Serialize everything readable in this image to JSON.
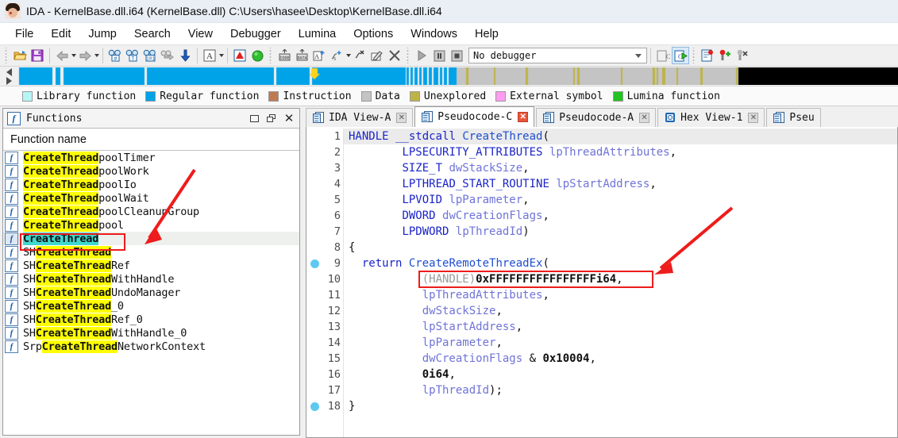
{
  "window": {
    "title": "IDA - KernelBase.dll.i64 (KernelBase.dll) C:\\Users\\hasee\\Desktop\\KernelBase.dll.i64",
    "app_icon": "ida-logo-icon"
  },
  "menubar": {
    "items": [
      "File",
      "Edit",
      "Jump",
      "Search",
      "View",
      "Debugger",
      "Lumina",
      "Options",
      "Windows",
      "Help"
    ]
  },
  "toolbar": {
    "debugger_select": {
      "value": "No debugger",
      "placeholder": "No debugger"
    },
    "buttons": [
      {
        "name": "open-file-icon",
        "glyph": "folder"
      },
      {
        "name": "save-file-icon",
        "glyph": "floppy"
      },
      {
        "name": "back-icon",
        "glyph": "arrow-left"
      },
      {
        "name": "back-dropdown-icon",
        "glyph": "caret"
      },
      {
        "name": "forward-icon",
        "glyph": "arrow-right"
      },
      {
        "name": "forward-dropdown-icon",
        "glyph": "caret"
      },
      {
        "name": "search-hash-icon",
        "glyph": "binoculars-hash"
      },
      {
        "name": "search-text-icon",
        "glyph": "binoculars-text"
      },
      {
        "name": "search-bytes-icon",
        "glyph": "binoculars-101"
      },
      {
        "name": "search-next-icon",
        "glyph": "binoculars-next"
      },
      {
        "name": "jump-down-icon",
        "glyph": "arrow-down"
      },
      {
        "name": "font-icon",
        "glyph": "letter-a"
      },
      {
        "name": "font-dropdown-icon",
        "glyph": "caret"
      },
      {
        "name": "warnings-icon",
        "glyph": "red-triangle"
      },
      {
        "name": "run-analysis-icon",
        "glyph": "green-circle"
      },
      {
        "name": "make-code-icon",
        "glyph": "code"
      },
      {
        "name": "make-data-icon",
        "glyph": "data"
      },
      {
        "name": "make-array-icon",
        "glyph": "array"
      },
      {
        "name": "make-struct-icon",
        "glyph": "struct"
      },
      {
        "name": "make-struct-dropdown-icon",
        "glyph": "caret"
      },
      {
        "name": "undefine-icon",
        "glyph": "undefine"
      },
      {
        "name": "rename-icon",
        "glyph": "rename"
      },
      {
        "name": "delete-icon",
        "glyph": "x-mark"
      },
      {
        "name": "debug-run-icon",
        "glyph": "play"
      },
      {
        "name": "debug-pause-icon",
        "glyph": "pause"
      },
      {
        "name": "debug-stop-icon",
        "glyph": "stop"
      },
      {
        "name": "decompile-icon",
        "glyph": "c-page"
      },
      {
        "name": "decompile-run-icon",
        "glyph": "c-page-run"
      },
      {
        "name": "breakpoint-list-icon",
        "glyph": "bp-list"
      },
      {
        "name": "breakpoint-add-icon",
        "glyph": "bp-add"
      },
      {
        "name": "breakpoint-del-icon",
        "glyph": "bp-del"
      }
    ]
  },
  "navband": {
    "left_arrow": "nav-prev-icon",
    "right_arrow": "nav-next-icon",
    "cursor_marker": "yellow-arrow-marker"
  },
  "legend": {
    "items": [
      {
        "label": "Library function",
        "color": "#b6f5f5"
      },
      {
        "label": "Regular function",
        "color": "#00a2e8"
      },
      {
        "label": "Instruction",
        "color": "#c07a52"
      },
      {
        "label": "Data",
        "color": "#c4c4c4"
      },
      {
        "label": "Unexplored",
        "color": "#bdb346"
      },
      {
        "label": "External symbol",
        "color": "#ff9cf0"
      },
      {
        "label": "Lumina function",
        "color": "#22c322"
      }
    ]
  },
  "functions_panel": {
    "title": "Functions",
    "icon": "function-panel-icon",
    "window_buttons": [
      "restore-button",
      "maximize-button",
      "close-button"
    ],
    "column_header": "Function name",
    "highlight_term": "CreateThread",
    "rows": [
      {
        "prefix": "",
        "match": "CreateThread",
        "suffix": "poolTimer",
        "selected": false
      },
      {
        "prefix": "",
        "match": "CreateThread",
        "suffix": "poolWork",
        "selected": false
      },
      {
        "prefix": "",
        "match": "CreateThread",
        "suffix": "poolIo",
        "selected": false
      },
      {
        "prefix": "",
        "match": "CreateThread",
        "suffix": "poolWait",
        "selected": false
      },
      {
        "prefix": "",
        "match": "CreateThread",
        "suffix": "poolCleanupGroup",
        "selected": false
      },
      {
        "prefix": "",
        "match": "CreateThread",
        "suffix": "pool",
        "selected": false
      },
      {
        "prefix": "",
        "match": "CreateThread",
        "suffix": "",
        "selected": true
      },
      {
        "prefix": "SH",
        "match": "CreateThread",
        "suffix": "",
        "selected": false
      },
      {
        "prefix": "SH",
        "match": "CreateThread",
        "suffix": "Ref",
        "selected": false
      },
      {
        "prefix": "SH",
        "match": "CreateThread",
        "suffix": "WithHandle",
        "selected": false
      },
      {
        "prefix": "SH",
        "match": "CreateThread",
        "suffix": "UndoManager",
        "selected": false
      },
      {
        "prefix": "SH",
        "match": "CreateThread",
        "suffix": "_0",
        "selected": false
      },
      {
        "prefix": "SH",
        "match": "CreateThread",
        "suffix": "Ref_0",
        "selected": false
      },
      {
        "prefix": "SH",
        "match": "CreateThread",
        "suffix": "WithHandle_0",
        "selected": false
      },
      {
        "prefix": "Srp",
        "match": "CreateThread",
        "suffix": "NetworkContext",
        "selected": false
      }
    ]
  },
  "tabs": [
    {
      "label": "IDA View-A",
      "icon": "page-icon",
      "active": false,
      "closable": true
    },
    {
      "label": "Pseudocode-C",
      "icon": "page-icon",
      "active": true,
      "closable": true
    },
    {
      "label": "Pseudocode-A",
      "icon": "page-icon",
      "active": false,
      "closable": true
    },
    {
      "label": "Hex View-1",
      "icon": "hex-icon",
      "active": false,
      "closable": true
    },
    {
      "label": "Pseu",
      "icon": "page-icon",
      "active": false,
      "closable": false
    }
  ],
  "code": {
    "lines": [
      {
        "n": "1",
        "bp": false,
        "current": true,
        "tokens": [
          {
            "t": "HANDLE",
            "c": "type"
          },
          {
            "t": " ",
            "c": "plain"
          },
          {
            "t": "__stdcall",
            "c": "kw"
          },
          {
            "t": " ",
            "c": "plain"
          },
          {
            "t": "CreateThread",
            "c": "fn"
          },
          {
            "t": "(",
            "c": "punct"
          }
        ]
      },
      {
        "n": "2",
        "bp": false,
        "current": false,
        "tokens": [
          {
            "t": "        ",
            "c": "plain"
          },
          {
            "t": "LPSECURITY_ATTRIBUTES",
            "c": "type"
          },
          {
            "t": " ",
            "c": "plain"
          },
          {
            "t": "lpThreadAttributes",
            "c": "var"
          },
          {
            "t": ",",
            "c": "punct"
          }
        ]
      },
      {
        "n": "3",
        "bp": false,
        "current": false,
        "tokens": [
          {
            "t": "        ",
            "c": "plain"
          },
          {
            "t": "SIZE_T",
            "c": "type"
          },
          {
            "t": " ",
            "c": "plain"
          },
          {
            "t": "dwStackSize",
            "c": "var"
          },
          {
            "t": ",",
            "c": "punct"
          }
        ]
      },
      {
        "n": "4",
        "bp": false,
        "current": false,
        "tokens": [
          {
            "t": "        ",
            "c": "plain"
          },
          {
            "t": "LPTHREAD_START_ROUTINE",
            "c": "type"
          },
          {
            "t": " ",
            "c": "plain"
          },
          {
            "t": "lpStartAddress",
            "c": "var"
          },
          {
            "t": ",",
            "c": "punct"
          }
        ]
      },
      {
        "n": "5",
        "bp": false,
        "current": false,
        "tokens": [
          {
            "t": "        ",
            "c": "plain"
          },
          {
            "t": "LPVOID",
            "c": "type"
          },
          {
            "t": " ",
            "c": "plain"
          },
          {
            "t": "lpParameter",
            "c": "var"
          },
          {
            "t": ",",
            "c": "punct"
          }
        ]
      },
      {
        "n": "6",
        "bp": false,
        "current": false,
        "tokens": [
          {
            "t": "        ",
            "c": "plain"
          },
          {
            "t": "DWORD",
            "c": "type"
          },
          {
            "t": " ",
            "c": "plain"
          },
          {
            "t": "dwCreationFlags",
            "c": "var"
          },
          {
            "t": ",",
            "c": "punct"
          }
        ]
      },
      {
        "n": "7",
        "bp": false,
        "current": false,
        "tokens": [
          {
            "t": "        ",
            "c": "plain"
          },
          {
            "t": "LPDWORD",
            "c": "type"
          },
          {
            "t": " ",
            "c": "plain"
          },
          {
            "t": "lpThreadId",
            "c": "var"
          },
          {
            "t": ")",
            "c": "punct"
          }
        ]
      },
      {
        "n": "8",
        "bp": false,
        "current": false,
        "tokens": [
          {
            "t": "{",
            "c": "punct"
          }
        ]
      },
      {
        "n": "9",
        "bp": true,
        "current": false,
        "tokens": [
          {
            "t": "  ",
            "c": "plain"
          },
          {
            "t": "return",
            "c": "kw"
          },
          {
            "t": " ",
            "c": "plain"
          },
          {
            "t": "CreateRemoteThreadEx",
            "c": "fn"
          },
          {
            "t": "(",
            "c": "punct"
          }
        ]
      },
      {
        "n": "10",
        "bp": false,
        "current": false,
        "tokens": [
          {
            "t": "           ",
            "c": "plain"
          },
          {
            "t": "(HANDLE)",
            "c": "cast"
          },
          {
            "t": "0xFFFFFFFFFFFFFFFFi64",
            "c": "num"
          },
          {
            "t": ",",
            "c": "punct"
          }
        ]
      },
      {
        "n": "11",
        "bp": false,
        "current": false,
        "tokens": [
          {
            "t": "           ",
            "c": "plain"
          },
          {
            "t": "lpThreadAttributes",
            "c": "var"
          },
          {
            "t": ",",
            "c": "punct"
          }
        ]
      },
      {
        "n": "12",
        "bp": false,
        "current": false,
        "tokens": [
          {
            "t": "           ",
            "c": "plain"
          },
          {
            "t": "dwStackSize",
            "c": "var"
          },
          {
            "t": ",",
            "c": "punct"
          }
        ]
      },
      {
        "n": "13",
        "bp": false,
        "current": false,
        "tokens": [
          {
            "t": "           ",
            "c": "plain"
          },
          {
            "t": "lpStartAddress",
            "c": "var"
          },
          {
            "t": ",",
            "c": "punct"
          }
        ]
      },
      {
        "n": "14",
        "bp": false,
        "current": false,
        "tokens": [
          {
            "t": "           ",
            "c": "plain"
          },
          {
            "t": "lpParameter",
            "c": "var"
          },
          {
            "t": ",",
            "c": "punct"
          }
        ]
      },
      {
        "n": "15",
        "bp": false,
        "current": false,
        "tokens": [
          {
            "t": "           ",
            "c": "plain"
          },
          {
            "t": "dwCreationFlags",
            "c": "var"
          },
          {
            "t": " & ",
            "c": "plain"
          },
          {
            "t": "0x10004",
            "c": "num"
          },
          {
            "t": ",",
            "c": "punct"
          }
        ]
      },
      {
        "n": "16",
        "bp": false,
        "current": false,
        "tokens": [
          {
            "t": "           ",
            "c": "plain"
          },
          {
            "t": "0i64",
            "c": "num"
          },
          {
            "t": ",",
            "c": "punct"
          }
        ]
      },
      {
        "n": "17",
        "bp": false,
        "current": false,
        "tokens": [
          {
            "t": "           ",
            "c": "plain"
          },
          {
            "t": "lpThreadId",
            "c": "var"
          },
          {
            "t": ");",
            "c": "punct"
          }
        ]
      },
      {
        "n": "18",
        "bp": true,
        "current": false,
        "tokens": [
          {
            "t": "}",
            "c": "punct"
          }
        ]
      }
    ]
  },
  "annotations": {
    "color": "#ee1c1c",
    "arrow_to_function_list": "red-arrow-pointing-to-createthread",
    "arrow_to_handle_value": "red-arrow-pointing-to-handle-cast",
    "box_function_list": "red-box-around-createthread-entry",
    "box_handle_value": "red-box-around-handle-constant"
  }
}
